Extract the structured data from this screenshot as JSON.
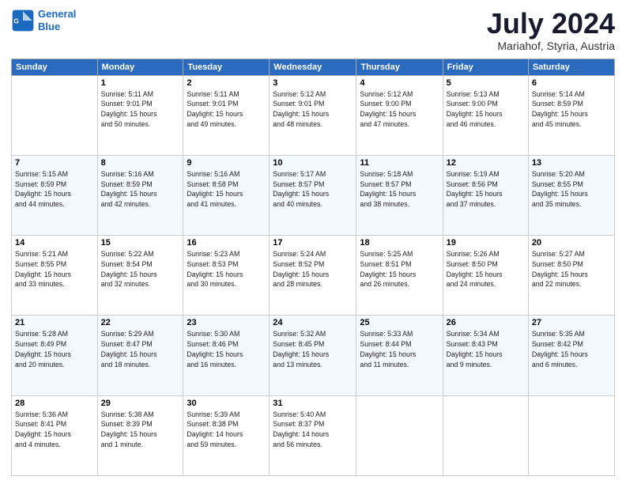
{
  "header": {
    "logo_line1": "General",
    "logo_line2": "Blue",
    "month": "July 2024",
    "location": "Mariahof, Styria, Austria"
  },
  "days_of_week": [
    "Sunday",
    "Monday",
    "Tuesday",
    "Wednesday",
    "Thursday",
    "Friday",
    "Saturday"
  ],
  "weeks": [
    [
      {
        "day": "",
        "info": ""
      },
      {
        "day": "1",
        "info": "Sunrise: 5:11 AM\nSunset: 9:01 PM\nDaylight: 15 hours\nand 50 minutes."
      },
      {
        "day": "2",
        "info": "Sunrise: 5:11 AM\nSunset: 9:01 PM\nDaylight: 15 hours\nand 49 minutes."
      },
      {
        "day": "3",
        "info": "Sunrise: 5:12 AM\nSunset: 9:01 PM\nDaylight: 15 hours\nand 48 minutes."
      },
      {
        "day": "4",
        "info": "Sunrise: 5:12 AM\nSunset: 9:00 PM\nDaylight: 15 hours\nand 47 minutes."
      },
      {
        "day": "5",
        "info": "Sunrise: 5:13 AM\nSunset: 9:00 PM\nDaylight: 15 hours\nand 46 minutes."
      },
      {
        "day": "6",
        "info": "Sunrise: 5:14 AM\nSunset: 8:59 PM\nDaylight: 15 hours\nand 45 minutes."
      }
    ],
    [
      {
        "day": "7",
        "info": "Sunrise: 5:15 AM\nSunset: 8:59 PM\nDaylight: 15 hours\nand 44 minutes."
      },
      {
        "day": "8",
        "info": "Sunrise: 5:16 AM\nSunset: 8:59 PM\nDaylight: 15 hours\nand 42 minutes."
      },
      {
        "day": "9",
        "info": "Sunrise: 5:16 AM\nSunset: 8:58 PM\nDaylight: 15 hours\nand 41 minutes."
      },
      {
        "day": "10",
        "info": "Sunrise: 5:17 AM\nSunset: 8:57 PM\nDaylight: 15 hours\nand 40 minutes."
      },
      {
        "day": "11",
        "info": "Sunrise: 5:18 AM\nSunset: 8:57 PM\nDaylight: 15 hours\nand 38 minutes."
      },
      {
        "day": "12",
        "info": "Sunrise: 5:19 AM\nSunset: 8:56 PM\nDaylight: 15 hours\nand 37 minutes."
      },
      {
        "day": "13",
        "info": "Sunrise: 5:20 AM\nSunset: 8:55 PM\nDaylight: 15 hours\nand 35 minutes."
      }
    ],
    [
      {
        "day": "14",
        "info": "Sunrise: 5:21 AM\nSunset: 8:55 PM\nDaylight: 15 hours\nand 33 minutes."
      },
      {
        "day": "15",
        "info": "Sunrise: 5:22 AM\nSunset: 8:54 PM\nDaylight: 15 hours\nand 32 minutes."
      },
      {
        "day": "16",
        "info": "Sunrise: 5:23 AM\nSunset: 8:53 PM\nDaylight: 15 hours\nand 30 minutes."
      },
      {
        "day": "17",
        "info": "Sunrise: 5:24 AM\nSunset: 8:52 PM\nDaylight: 15 hours\nand 28 minutes."
      },
      {
        "day": "18",
        "info": "Sunrise: 5:25 AM\nSunset: 8:51 PM\nDaylight: 15 hours\nand 26 minutes."
      },
      {
        "day": "19",
        "info": "Sunrise: 5:26 AM\nSunset: 8:50 PM\nDaylight: 15 hours\nand 24 minutes."
      },
      {
        "day": "20",
        "info": "Sunrise: 5:27 AM\nSunset: 8:50 PM\nDaylight: 15 hours\nand 22 minutes."
      }
    ],
    [
      {
        "day": "21",
        "info": "Sunrise: 5:28 AM\nSunset: 8:49 PM\nDaylight: 15 hours\nand 20 minutes."
      },
      {
        "day": "22",
        "info": "Sunrise: 5:29 AM\nSunset: 8:47 PM\nDaylight: 15 hours\nand 18 minutes."
      },
      {
        "day": "23",
        "info": "Sunrise: 5:30 AM\nSunset: 8:46 PM\nDaylight: 15 hours\nand 16 minutes."
      },
      {
        "day": "24",
        "info": "Sunrise: 5:32 AM\nSunset: 8:45 PM\nDaylight: 15 hours\nand 13 minutes."
      },
      {
        "day": "25",
        "info": "Sunrise: 5:33 AM\nSunset: 8:44 PM\nDaylight: 15 hours\nand 11 minutes."
      },
      {
        "day": "26",
        "info": "Sunrise: 5:34 AM\nSunset: 8:43 PM\nDaylight: 15 hours\nand 9 minutes."
      },
      {
        "day": "27",
        "info": "Sunrise: 5:35 AM\nSunset: 8:42 PM\nDaylight: 15 hours\nand 6 minutes."
      }
    ],
    [
      {
        "day": "28",
        "info": "Sunrise: 5:36 AM\nSunset: 8:41 PM\nDaylight: 15 hours\nand 4 minutes."
      },
      {
        "day": "29",
        "info": "Sunrise: 5:38 AM\nSunset: 8:39 PM\nDaylight: 15 hours\nand 1 minute."
      },
      {
        "day": "30",
        "info": "Sunrise: 5:39 AM\nSunset: 8:38 PM\nDaylight: 14 hours\nand 59 minutes."
      },
      {
        "day": "31",
        "info": "Sunrise: 5:40 AM\nSunset: 8:37 PM\nDaylight: 14 hours\nand 56 minutes."
      },
      {
        "day": "",
        "info": ""
      },
      {
        "day": "",
        "info": ""
      },
      {
        "day": "",
        "info": ""
      }
    ]
  ]
}
